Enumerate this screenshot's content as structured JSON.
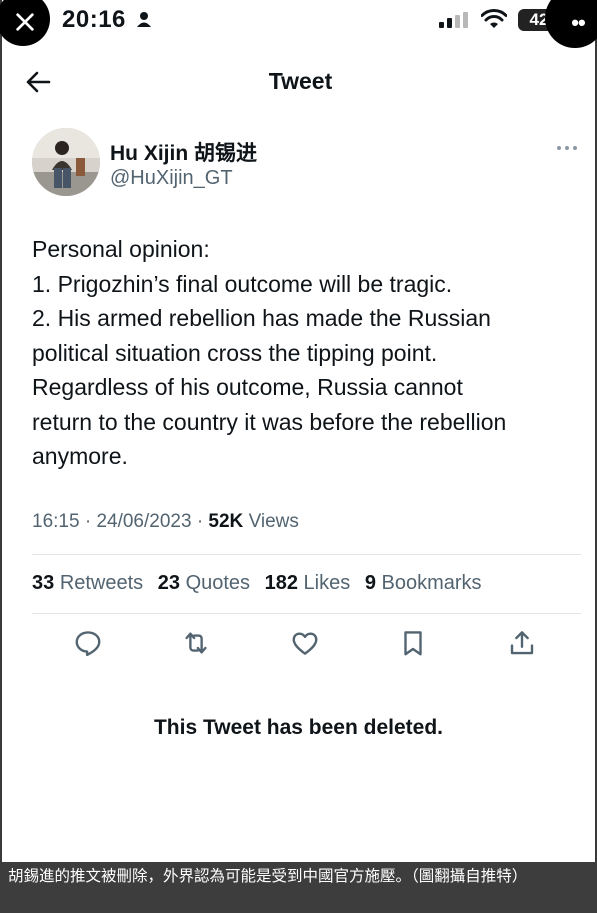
{
  "status_bar": {
    "time": "20:16",
    "battery": "42",
    "more_label": "••"
  },
  "header": {
    "title": "Tweet"
  },
  "author": {
    "name": "Hu Xijin 胡锡进",
    "handle": "@HuXijin_GT"
  },
  "tweet": {
    "lines": [
      "Personal opinion:",
      "1. Prigozhin’s final outcome will be tragic.",
      "2. His armed rebellion has made the Russian",
      "political situation cross the tipping point.",
      "Regardless of his outcome, Russia cannot",
      "return to the country it was before the rebellion",
      "anymore."
    ],
    "time": "16:15",
    "date": "24/06/2023",
    "views_count": "52K",
    "views_label": "Views"
  },
  "stats": {
    "retweets_count": "33",
    "retweets_label": "Retweets",
    "quotes_count": "23",
    "quotes_label": "Quotes",
    "likes_count": "182",
    "likes_label": "Likes",
    "bookmarks_count": "9",
    "bookmarks_label": "Bookmarks"
  },
  "actions": [
    "reply-icon",
    "retweet-icon",
    "like-icon",
    "bookmark-icon",
    "share-icon"
  ],
  "deleted_notice": "This Tweet has been deleted.",
  "caption": "胡錫進的推文被刪除，外界認為可能是受到中國官方施壓。（圖翻攝自推特）",
  "colors": {
    "text": "#0f1419",
    "secondary": "#536471",
    "divider": "#e3e6e8",
    "caption_bg": "#3d3d3d"
  }
}
